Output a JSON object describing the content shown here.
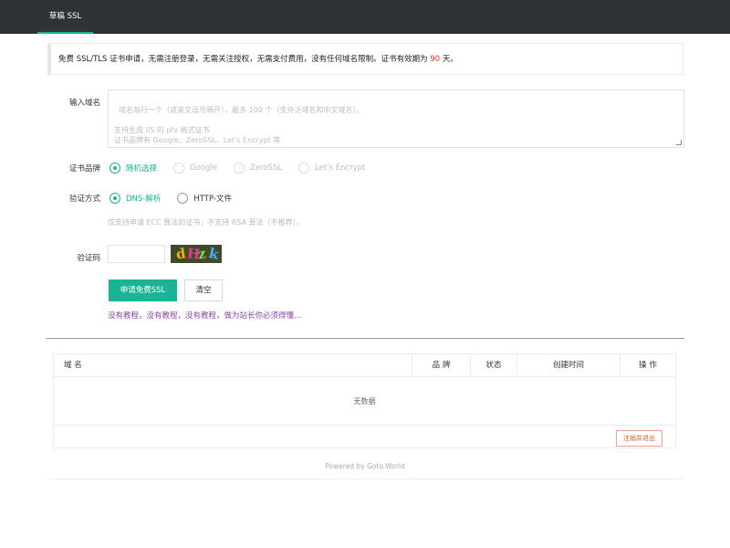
{
  "nav": {
    "tab_label": "草稿 SSL"
  },
  "notice": {
    "text_before": "免费 SSL/TLS 证书申请，无需注册登录，无需关注授权，无需支付费用，没有任何域名限制。证书有效期为 ",
    "days": "90",
    "text_after": " 天。",
    "highlight_color": "#d9302a"
  },
  "form": {
    "domain_label": "输入域名",
    "domain_placeholder": "域名每行一个（或英文逗号隔开），最多 100 个（支持泛域名和中文域名）。\n\n支持生成 IIS 的 pfx 格式证书\n证书品牌有 Google、ZeroSSL、Let's Encrypt 等",
    "brand_label": "证书品牌",
    "brand_options": [
      "随机选择",
      "Google",
      "ZeroSSL",
      "Let's Encrypt"
    ],
    "brand_selected": "随机选择",
    "verify_label": "验证方式",
    "verify_options": [
      "DNS-解析",
      "HTTP-文件"
    ],
    "verify_selected": "DNS-解析",
    "hint": "仅支持申请 ECC 算法的证书，不支持 RSA 算法（不推荐）。",
    "captcha_label": "验证码",
    "captcha_chars": [
      "d",
      "H",
      "z",
      "k"
    ],
    "submit_label": "申请免费SSL",
    "clear_label": "清空",
    "tutorial_text": "没有教程，没有教程，没有教程，做为站长你必须得懂…",
    "accent_color": "#1ab394"
  },
  "table": {
    "columns": [
      "域 名",
      "品 牌",
      "状态",
      "创建时间",
      "操 作"
    ],
    "empty_text": "无数据",
    "logout_label": "注销并退出"
  },
  "footer": {
    "text": "Powered by Goto.World"
  }
}
